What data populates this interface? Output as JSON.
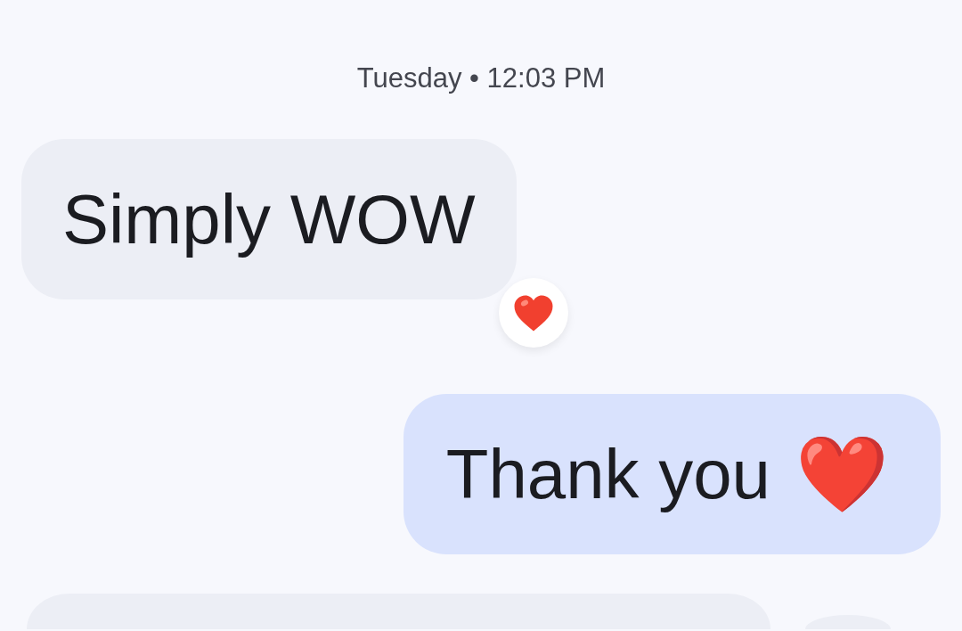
{
  "timestamp": "Tuesday • 12:03 PM",
  "messages": [
    {
      "kind": "incoming",
      "text": "Simply WOW",
      "reacted": true
    },
    {
      "kind": "outgoing",
      "text": "Thank you",
      "emoji": "❤️",
      "reacted": false
    },
    {
      "kind": "incoming",
      "reacted": false
    }
  ]
}
